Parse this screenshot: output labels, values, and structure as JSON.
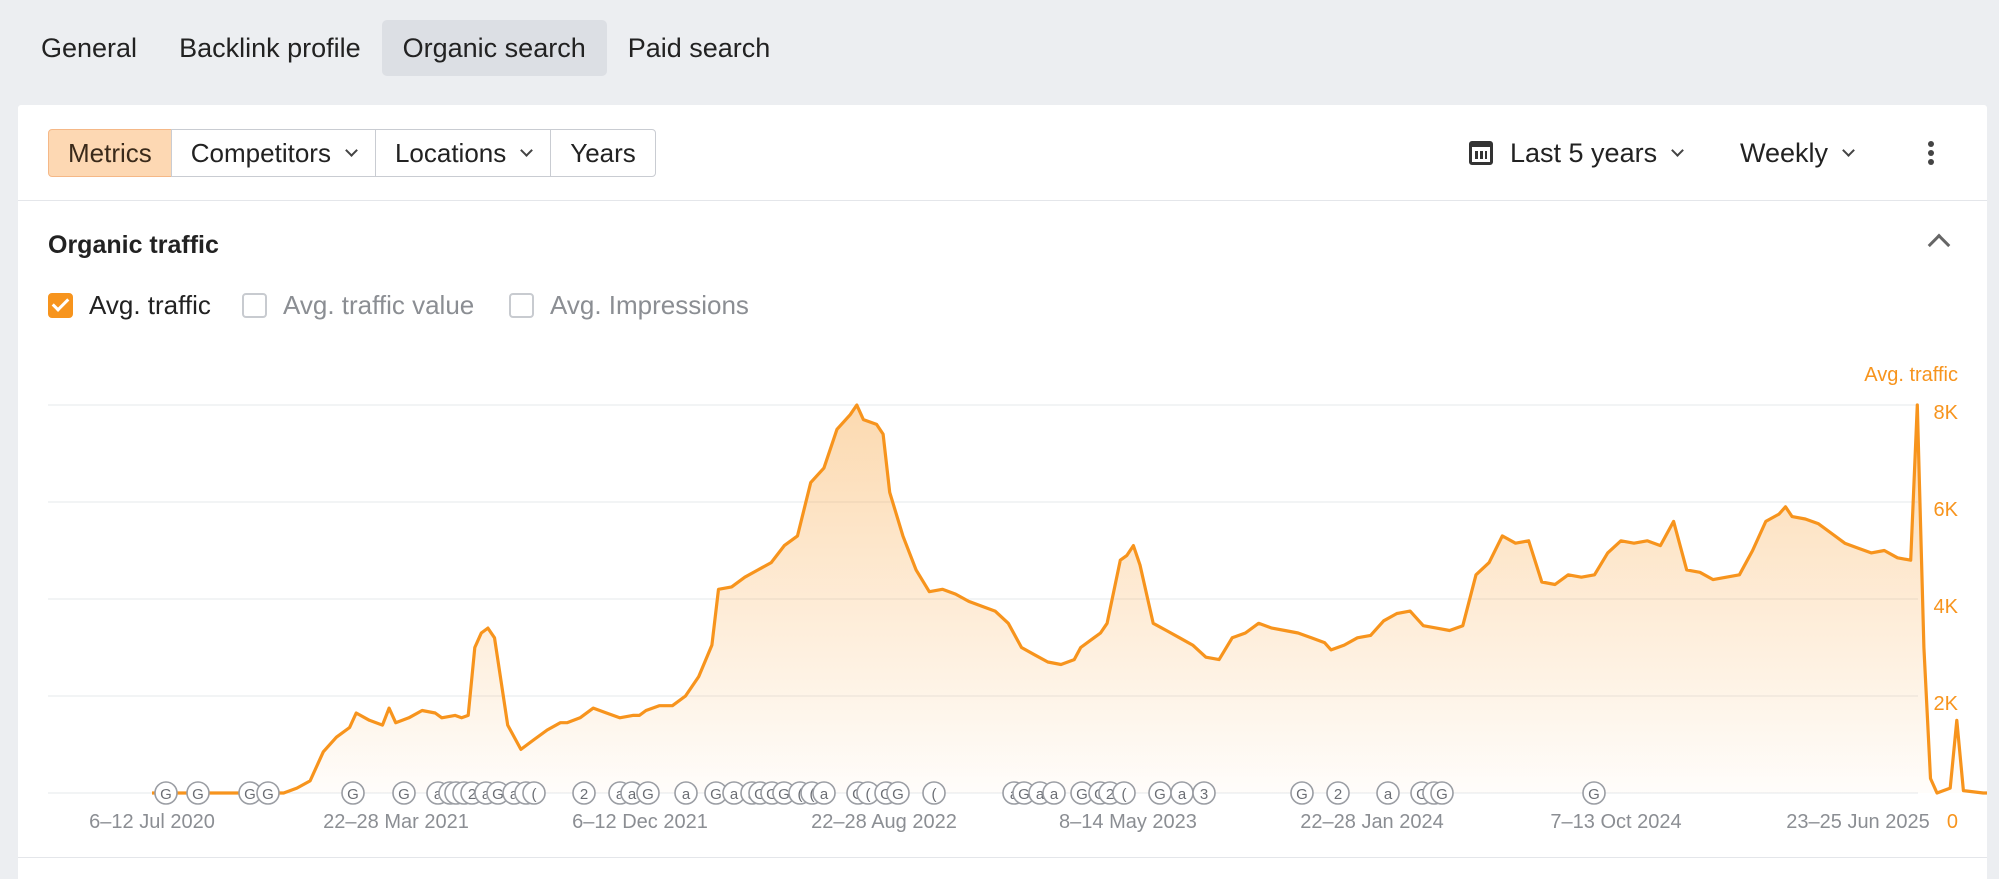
{
  "tabs": [
    "General",
    "Backlink profile",
    "Organic search",
    "Paid search"
  ],
  "active_tab": 2,
  "toolbar": {
    "segments": [
      "Metrics",
      "Competitors",
      "Locations",
      "Years"
    ],
    "period": "Last 5 years",
    "interval": "Weekly"
  },
  "section": {
    "title": "Organic traffic",
    "checkboxes": [
      {
        "label": "Avg. traffic",
        "checked": true
      },
      {
        "label": "Avg. traffic value",
        "checked": false
      },
      {
        "label": "Avg. Impressions",
        "checked": false
      }
    ]
  },
  "colors": {
    "accent": "#f7941d",
    "accent_light": "#fdd8b3",
    "grid": "#e6e8eb",
    "marker": "#9a9da3"
  },
  "chart_data": {
    "type": "area",
    "series_name": "Avg. traffic",
    "y_axis_label": "Avg. traffic",
    "ylim": [
      0,
      8000
    ],
    "y_ticks": [
      "0",
      "2K",
      "4K",
      "6K",
      "8K"
    ],
    "x_ticks": [
      "6–12 Jul 2020",
      "22–28 Mar 2021",
      "6–12 Dec 2021",
      "22–28 Aug 2022",
      "8–14 May 2023",
      "22–28 Jan 2024",
      "7–13 Oct 2024",
      "23–25 Jun 2025"
    ],
    "x_domain": [
      "2020-07-06",
      "2025-06-23"
    ],
    "grid": true,
    "points": [
      [
        "2020-07-06",
        0
      ],
      [
        "2020-09-28",
        0
      ],
      [
        "2020-11-23",
        0
      ],
      [
        "2020-12-07",
        100
      ],
      [
        "2020-12-21",
        250
      ],
      [
        "2021-01-04",
        850
      ],
      [
        "2021-01-18",
        1150
      ],
      [
        "2021-02-01",
        1350
      ],
      [
        "2021-02-08",
        1650
      ],
      [
        "2021-02-22",
        1500
      ],
      [
        "2021-03-08",
        1400
      ],
      [
        "2021-03-15",
        1750
      ],
      [
        "2021-03-22",
        1450
      ],
      [
        "2021-04-05",
        1550
      ],
      [
        "2021-04-19",
        1700
      ],
      [
        "2021-05-03",
        1650
      ],
      [
        "2021-05-10",
        1550
      ],
      [
        "2021-05-24",
        1600
      ],
      [
        "2021-05-31",
        1550
      ],
      [
        "2021-06-07",
        1600
      ],
      [
        "2021-06-14",
        3000
      ],
      [
        "2021-06-21",
        3300
      ],
      [
        "2021-06-28",
        3400
      ],
      [
        "2021-07-05",
        3200
      ],
      [
        "2021-07-19",
        1400
      ],
      [
        "2021-08-02",
        900
      ],
      [
        "2021-08-16",
        1100
      ],
      [
        "2021-08-30",
        1300
      ],
      [
        "2021-09-13",
        1450
      ],
      [
        "2021-09-20",
        1450
      ],
      [
        "2021-10-04",
        1550
      ],
      [
        "2021-10-18",
        1750
      ],
      [
        "2021-11-01",
        1650
      ],
      [
        "2021-11-15",
        1550
      ],
      [
        "2021-11-29",
        1600
      ],
      [
        "2021-12-06",
        1600
      ],
      [
        "2021-12-13",
        1700
      ],
      [
        "2021-12-27",
        1800
      ],
      [
        "2022-01-10",
        1800
      ],
      [
        "2022-01-24",
        2000
      ],
      [
        "2022-02-07",
        2400
      ],
      [
        "2022-02-21",
        3050
      ],
      [
        "2022-02-28",
        4200
      ],
      [
        "2022-03-14",
        4250
      ],
      [
        "2022-03-28",
        4450
      ],
      [
        "2022-04-11",
        4600
      ],
      [
        "2022-04-25",
        4750
      ],
      [
        "2022-05-09",
        5100
      ],
      [
        "2022-05-23",
        5300
      ],
      [
        "2022-06-06",
        6400
      ],
      [
        "2022-06-20",
        6700
      ],
      [
        "2022-07-04",
        7500
      ],
      [
        "2022-07-18",
        7800
      ],
      [
        "2022-07-25",
        8000
      ],
      [
        "2022-08-01",
        7700
      ],
      [
        "2022-08-15",
        7600
      ],
      [
        "2022-08-22",
        7400
      ],
      [
        "2022-08-29",
        6200
      ],
      [
        "2022-09-12",
        5300
      ],
      [
        "2022-09-26",
        4600
      ],
      [
        "2022-10-10",
        4150
      ],
      [
        "2022-10-24",
        4200
      ],
      [
        "2022-11-07",
        4100
      ],
      [
        "2022-11-21",
        3950
      ],
      [
        "2022-12-05",
        3850
      ],
      [
        "2022-12-19",
        3750
      ],
      [
        "2023-01-02",
        3500
      ],
      [
        "2023-01-16",
        3000
      ],
      [
        "2023-01-30",
        2850
      ],
      [
        "2023-02-13",
        2700
      ],
      [
        "2023-02-27",
        2650
      ],
      [
        "2023-03-13",
        2750
      ],
      [
        "2023-03-20",
        3000
      ],
      [
        "2023-04-03",
        3200
      ],
      [
        "2023-04-10",
        3300
      ],
      [
        "2023-04-17",
        3500
      ],
      [
        "2023-05-01",
        4800
      ],
      [
        "2023-05-08",
        4900
      ],
      [
        "2023-05-15",
        5100
      ],
      [
        "2023-05-22",
        4700
      ],
      [
        "2023-06-05",
        3500
      ],
      [
        "2023-06-19",
        3350
      ],
      [
        "2023-07-03",
        3200
      ],
      [
        "2023-07-17",
        3050
      ],
      [
        "2023-07-31",
        2800
      ],
      [
        "2023-08-14",
        2750
      ],
      [
        "2023-08-28",
        3200
      ],
      [
        "2023-09-11",
        3300
      ],
      [
        "2023-09-25",
        3500
      ],
      [
        "2023-10-09",
        3400
      ],
      [
        "2023-10-23",
        3350
      ],
      [
        "2023-11-06",
        3300
      ],
      [
        "2023-11-20",
        3200
      ],
      [
        "2023-12-04",
        3100
      ],
      [
        "2023-12-11",
        2950
      ],
      [
        "2023-12-25",
        3050
      ],
      [
        "2024-01-08",
        3200
      ],
      [
        "2024-01-22",
        3250
      ],
      [
        "2024-02-05",
        3550
      ],
      [
        "2024-02-19",
        3700
      ],
      [
        "2024-03-04",
        3750
      ],
      [
        "2024-03-18",
        3450
      ],
      [
        "2024-04-01",
        3400
      ],
      [
        "2024-04-15",
        3350
      ],
      [
        "2024-04-29",
        3450
      ],
      [
        "2024-05-13",
        4500
      ],
      [
        "2024-05-27",
        4750
      ],
      [
        "2024-06-10",
        5300
      ],
      [
        "2024-06-24",
        5150
      ],
      [
        "2024-07-08",
        5200
      ],
      [
        "2024-07-22",
        4350
      ],
      [
        "2024-08-05",
        4300
      ],
      [
        "2024-08-19",
        4500
      ],
      [
        "2024-09-02",
        4450
      ],
      [
        "2024-09-16",
        4500
      ],
      [
        "2024-09-30",
        4950
      ],
      [
        "2024-10-14",
        5200
      ],
      [
        "2024-10-28",
        5150
      ],
      [
        "2024-11-11",
        5200
      ],
      [
        "2024-11-25",
        5100
      ],
      [
        "2024-12-09",
        5600
      ],
      [
        "2024-12-23",
        4600
      ],
      [
        "2025-01-06",
        4550
      ],
      [
        "2025-01-20",
        4400
      ],
      [
        "2025-02-03",
        4450
      ],
      [
        "2025-02-17",
        4500
      ],
      [
        "2025-03-03",
        5000
      ],
      [
        "2025-03-17",
        5600
      ],
      [
        "2025-03-31",
        5750
      ],
      [
        "2025-04-07",
        5900
      ],
      [
        "2025-04-14",
        5700
      ],
      [
        "2025-04-28",
        5650
      ],
      [
        "2025-05-12",
        5550
      ],
      [
        "2025-05-26",
        5350
      ],
      [
        "2025-06-09",
        5150
      ],
      [
        "2025-06-23",
        5050
      ],
      [
        "2025-07-07",
        4950
      ],
      [
        "2025-07-21",
        5000
      ],
      [
        "2025-08-04",
        4850
      ],
      [
        "2025-08-18",
        4800
      ],
      [
        "2025-08-25",
        8000
      ],
      [
        "2025-09-01",
        3000
      ],
      [
        "2025-09-08",
        300
      ],
      [
        "2025-09-15",
        0
      ],
      [
        "2025-09-29",
        100
      ],
      [
        "2025-10-06",
        1500
      ],
      [
        "2025-10-13",
        50
      ],
      [
        "2025-11-03",
        0
      ],
      [
        "2025-12-29",
        0
      ]
    ],
    "event_markers": [
      "G",
      "G",
      "G",
      "G",
      "G",
      "G",
      "a",
      "(",
      "(",
      "(",
      "2",
      "a",
      "G",
      "a",
      "(",
      "(",
      "2",
      "a",
      "a",
      "G",
      "a",
      "G",
      "a",
      "a",
      "G",
      "G",
      "G",
      "(",
      "(",
      "a",
      "G",
      "(",
      "G",
      "G",
      "(",
      "a",
      "G",
      "a",
      "a",
      "G",
      "G",
      "2",
      "(",
      "G",
      "a",
      "3",
      "G",
      "2",
      "a",
      "G",
      "(",
      "G",
      "G"
    ]
  }
}
